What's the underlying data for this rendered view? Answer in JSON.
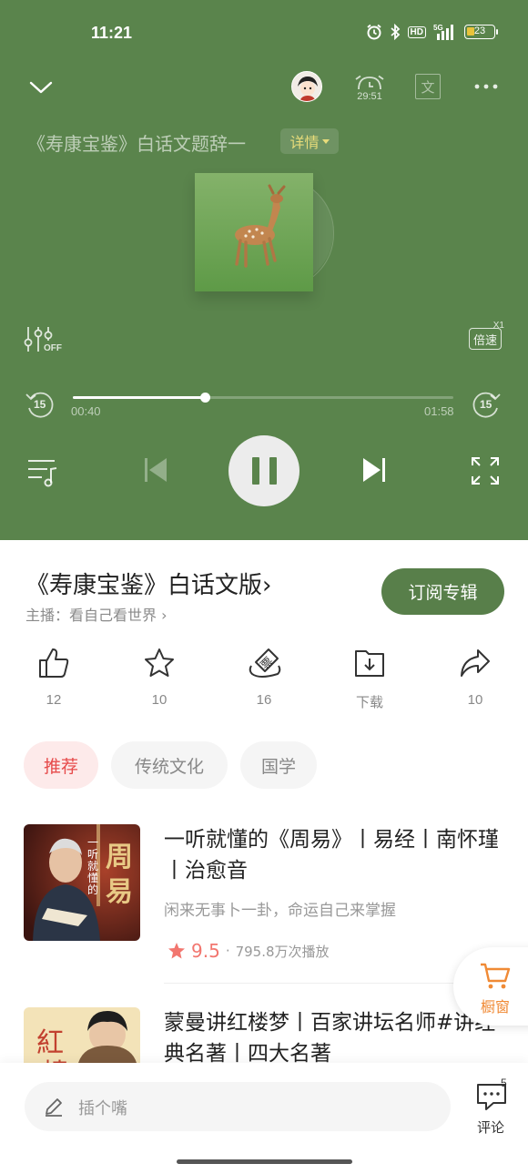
{
  "status_bar": {
    "time": "11:21",
    "battery": "23",
    "network": "HD",
    "signal": "5G"
  },
  "player": {
    "bg_color": "#5a844c",
    "timer_text": "29:51",
    "track_title": "《寿康宝鉴》白话文题辞一",
    "details_label": "详情",
    "speed_label": "倍速",
    "speed_badge": "X1",
    "eq_off_label": "OFF",
    "skip_back": "15",
    "skip_forward": "15",
    "current_time": "00:40",
    "total_time": "01:58",
    "progress": 0.346,
    "is_playing": true,
    "translate_label": "文"
  },
  "album": {
    "title": "《寿康宝鉴》白话文版›",
    "host_prefix": "主播：",
    "host_name": "看自己看世界 ›",
    "subscribe_label": "订阅专辑"
  },
  "actions": [
    {
      "name": "like",
      "label": "12"
    },
    {
      "name": "favorite",
      "label": "10"
    },
    {
      "name": "ticket",
      "label": "16",
      "icon_text": "票"
    },
    {
      "name": "download",
      "label": "下载"
    },
    {
      "name": "share",
      "label": "10"
    }
  ],
  "tags": [
    {
      "label": "推荐",
      "active": true
    },
    {
      "label": "传统文化",
      "active": false
    },
    {
      "label": "国学",
      "active": false
    }
  ],
  "recommendations": [
    {
      "title": "一听就懂的《周易》丨易经丨南怀瑾丨治愈音",
      "subtitle": "闲来无事卜一卦，命运自己来掌握",
      "score": "9.5",
      "plays": "795.8万次播放",
      "cover_text_a": "一听就懂的",
      "cover_text_b": "周易"
    },
    {
      "title": "蒙曼讲红楼梦丨百家讲坛名师#讲经典名著丨四大名著",
      "cover_text_a": "紅",
      "cover_text_b": "樓"
    }
  ],
  "shop": {
    "label": "橱窗"
  },
  "comment": {
    "placeholder": "插个嘴",
    "label": "评论",
    "count": "5"
  }
}
